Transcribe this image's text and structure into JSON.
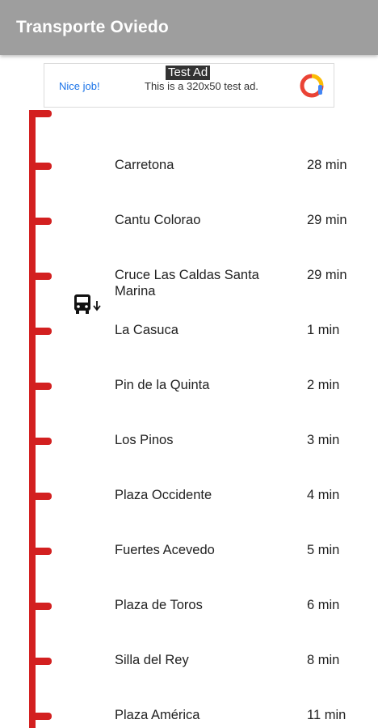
{
  "app": {
    "title": "Transporte Oviedo"
  },
  "ad": {
    "badge": "Test Ad",
    "cta": "Nice job!",
    "message": "This is a 320x50 test ad.",
    "logo_icon": "admob-logo-icon"
  },
  "colors": {
    "appbar": "#9e9e9e",
    "rail": "#d32020"
  },
  "bus_icon": "bus-arrival-icon",
  "stops": [
    {
      "name": "Carretona",
      "time": "28 min"
    },
    {
      "name": "Cantu Colorao",
      "time": "29 min"
    },
    {
      "name": "Cruce Las Caldas Santa Marina",
      "time": "29 min"
    },
    {
      "name": "La Casuca",
      "time": "1 min"
    },
    {
      "name": "Pin de la Quinta",
      "time": "2 min"
    },
    {
      "name": "Los Pinos",
      "time": "3 min"
    },
    {
      "name": "Plaza Occidente",
      "time": "4 min"
    },
    {
      "name": "Fuertes Acevedo",
      "time": "5 min"
    },
    {
      "name": "Plaza de Toros",
      "time": "6 min"
    },
    {
      "name": "Silla del Rey",
      "time": "8 min"
    },
    {
      "name": "Plaza América",
      "time": "11 min"
    }
  ]
}
